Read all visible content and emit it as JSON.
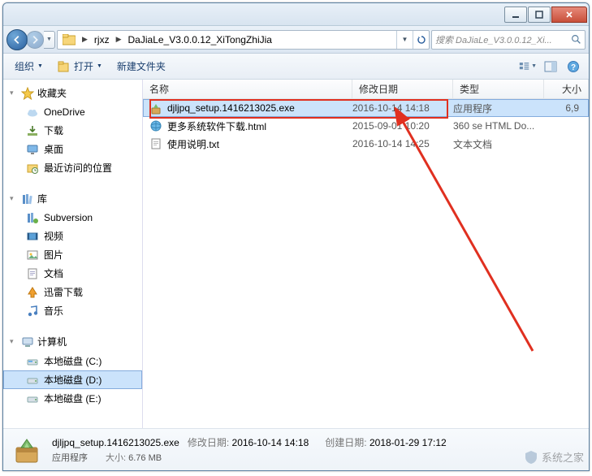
{
  "titlebar": {},
  "address": {
    "segments": [
      "rjxz",
      "DaJiaLe_V3.0.0.12_XiTongZhiJia"
    ],
    "search_placeholder": "搜索 DaJiaLe_V3.0.0.12_Xi..."
  },
  "toolbar": {
    "organize": "组织",
    "open": "打开",
    "newfolder": "新建文件夹"
  },
  "sidebar": {
    "favorites": {
      "label": "收藏夹",
      "items": [
        {
          "label": "OneDrive",
          "icon": "cloud"
        },
        {
          "label": "下载",
          "icon": "download"
        },
        {
          "label": "桌面",
          "icon": "desktop"
        },
        {
          "label": "最近访问的位置",
          "icon": "recent"
        }
      ]
    },
    "libraries": {
      "label": "库",
      "items": [
        {
          "label": "Subversion",
          "icon": "svn"
        },
        {
          "label": "视频",
          "icon": "video"
        },
        {
          "label": "图片",
          "icon": "pic"
        },
        {
          "label": "文档",
          "icon": "doc"
        },
        {
          "label": "迅雷下载",
          "icon": "xl"
        },
        {
          "label": "音乐",
          "icon": "music"
        }
      ]
    },
    "computer": {
      "label": "计算机",
      "items": [
        {
          "label": "本地磁盘 (C:)",
          "icon": "disk-c"
        },
        {
          "label": "本地磁盘 (D:)",
          "icon": "disk",
          "selected": true
        },
        {
          "label": "本地磁盘 (E:)",
          "icon": "disk"
        }
      ]
    }
  },
  "columns": {
    "name": "名称",
    "date": "修改日期",
    "type": "类型",
    "size": "大小"
  },
  "files": [
    {
      "name": "djljpq_setup.1416213025.exe",
      "date": "2016-10-14 14:18",
      "type": "应用程序",
      "size": "6,9",
      "icon": "exe",
      "selected": true
    },
    {
      "name": "更多系统软件下载.html",
      "date": "2015-09-01 10:20",
      "type": "360 se HTML Do...",
      "size": "",
      "icon": "html"
    },
    {
      "name": "使用说明.txt",
      "date": "2016-10-14 14:25",
      "type": "文本文档",
      "size": "",
      "icon": "txt"
    }
  ],
  "details": {
    "filename": "djljpq_setup.1416213025.exe",
    "filetype": "应用程序",
    "date_label": "修改日期:",
    "date": "2016-10-14 14:18",
    "size_label": "大小:",
    "size": "6.76 MB",
    "created_label": "创建日期:",
    "created": "2018-01-29 17:12"
  },
  "watermark": "系统之家"
}
